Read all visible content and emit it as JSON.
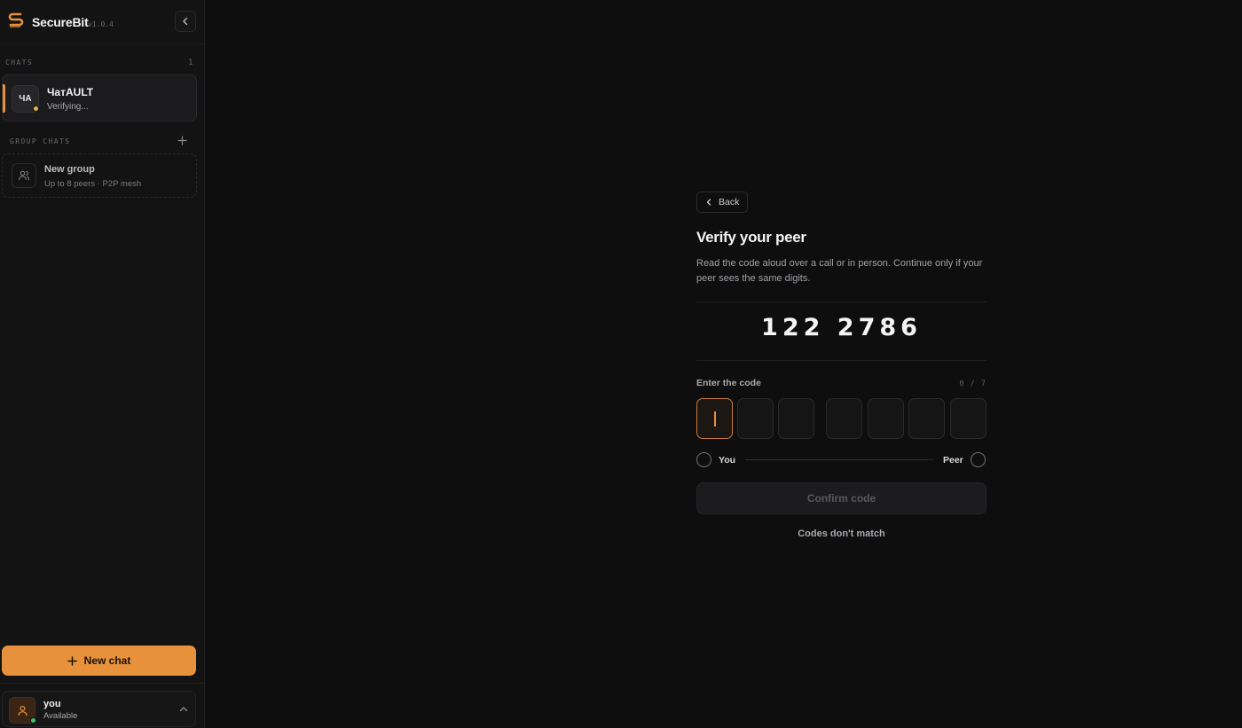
{
  "app": {
    "name": "SecureBit",
    "version": "v1.0.4"
  },
  "sidebar": {
    "chats_label": "CHATS",
    "chats_count": "1",
    "chats": [
      {
        "initials": "ЧА",
        "name": "ЧатAULT",
        "status": "Verifying..."
      }
    ],
    "group_label": "GROUP CHATS",
    "new_group": {
      "title": "New group",
      "subtitle": "Up to 8 peers · P2P mesh"
    },
    "new_chat_label": "New chat",
    "user": {
      "name": "you",
      "status": "Available"
    }
  },
  "verify": {
    "back_label": "Back",
    "title": "Verify your peer",
    "description": "Read the code aloud over a call or in person. Continue only if your peer sees the same digits.",
    "code": "122 2786",
    "enter_label": "Enter the code",
    "enter_count": "0 / 7",
    "you_label": "You",
    "peer_label": "Peer",
    "confirm_label": "Confirm code",
    "mismatch_label": "Codes don't match"
  },
  "colors": {
    "accent": "#e8913d",
    "verifying_dot": "#e8b43d",
    "online_dot": "#3ec46d"
  }
}
